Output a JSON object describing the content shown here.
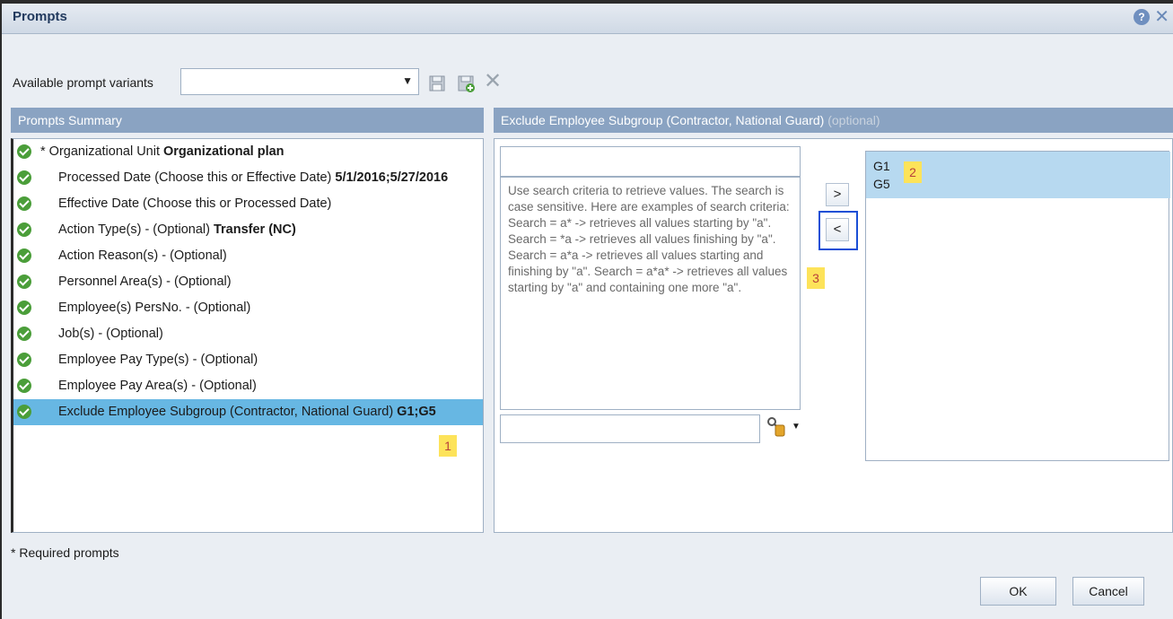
{
  "window": {
    "title": "Prompts"
  },
  "variants": {
    "label": "Available prompt variants",
    "value": ""
  },
  "summary": {
    "header": "Prompts Summary",
    "items": [
      {
        "prefix": "* Organizational Unit",
        "value": "Organizational plan",
        "required": true
      },
      {
        "prefix": "Processed Date (Choose this or Effective Date)",
        "value": "5/1/2016;5/27/2016"
      },
      {
        "prefix": "Effective Date (Choose this or Processed Date)",
        "value": ""
      },
      {
        "prefix": "Action Type(s) - (Optional)",
        "value": "Transfer (NC)"
      },
      {
        "prefix": "Action Reason(s) - (Optional)",
        "value": ""
      },
      {
        "prefix": "Personnel Area(s) - (Optional)",
        "value": ""
      },
      {
        "prefix": "Employee(s) PersNo. - (Optional)",
        "value": ""
      },
      {
        "prefix": "Job(s) - (Optional)",
        "value": ""
      },
      {
        "prefix": "Employee Pay Type(s) - (Optional)",
        "value": ""
      },
      {
        "prefix": "Employee Pay Area(s) - (Optional)",
        "value": ""
      },
      {
        "prefix": "Exclude Employee Subgroup (Contractor, National Guard)",
        "value": "G1;G5",
        "selected": true
      }
    ]
  },
  "detail": {
    "header": "Exclude Employee Subgroup (Contractor, National Guard)",
    "optional": "(optional)",
    "search_value": "",
    "hint": "Use search criteria to retrieve values. The search is case sensitive. Here are examples of search criteria: Search = a* -> retrieves all values starting by \"a\". Search = *a -> retrieves all values finishing by \"a\". Search = a*a -> retrieves all values starting and finishing by \"a\". Search = a*a* -> retrieves all values starting by \"a\" and containing one more \"a\".",
    "add_label": ">",
    "remove_label": "<",
    "selected_values": [
      "G1",
      "G5"
    ]
  },
  "annotations": {
    "one": "1",
    "two": "2",
    "three": "3"
  },
  "footer": {
    "required_note": "* Required prompts",
    "ok": "OK",
    "cancel": "Cancel"
  },
  "icons": {
    "help": "help-icon",
    "close": "close-icon",
    "save": "save-icon",
    "save_as": "save-as-icon",
    "delete": "delete-icon",
    "search_options": "search-tools-icon",
    "check": "check-circle-icon"
  },
  "colors": {
    "panel_header": "#8aa3c2",
    "selection": "#67b7e3",
    "annotation_bg": "#fde35a",
    "highlight_border": "#1a4fd6"
  }
}
